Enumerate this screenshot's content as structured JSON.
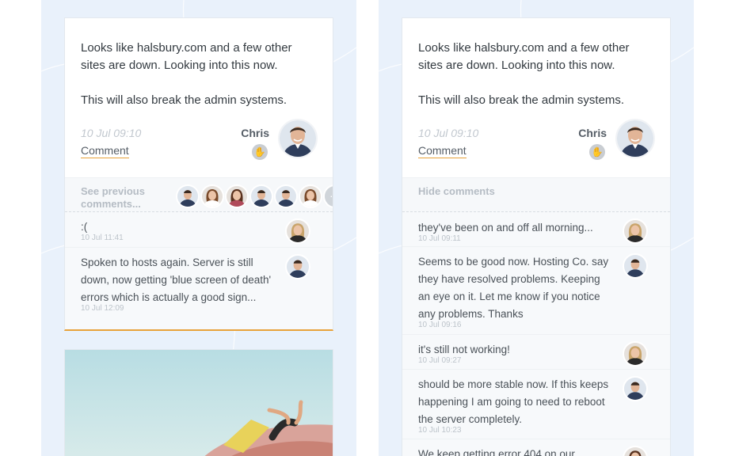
{
  "left_card": {
    "post_line1": "Looks like halsbury.com and a few other sites are down. Looking into this now.",
    "post_line2": "This will also break the admin systems.",
    "date": "10 Jul 09:10",
    "comment_link": "Comment",
    "author": "Chris",
    "author_avatar": "avatar-man-icon",
    "hand_icon": "hand-wave-icon",
    "see_previous": "See previous comments...",
    "face_icons": [
      "avatar-man-icon",
      "avatar-woman-icon",
      "avatar-woman-icon",
      "avatar-man-icon",
      "avatar-man-icon",
      "avatar-woman-icon"
    ],
    "more_dots": "···",
    "comments": [
      {
        "text": ":(",
        "time": "10 Jul 11:41",
        "avatar": "avatar-woman-icon"
      },
      {
        "text": "Spoken to hosts again. Server is still down, now getting 'blue screen of death' errors which is actually a good sign...",
        "time": "10 Jul 12:09",
        "avatar": "avatar-man-icon"
      }
    ]
  },
  "right_card": {
    "post_line1": "Looks like halsbury.com and a few other sites are down. Looking into this now.",
    "post_line2": "This will also break the admin systems.",
    "date": "10 Jul 09:10",
    "comment_link": "Comment",
    "author": "Chris",
    "author_avatar": "avatar-man-icon",
    "hand_icon": "hand-wave-icon",
    "hide_comments": "Hide comments",
    "comments": [
      {
        "text": "they've been on and off all morning...",
        "time": "10 Jul 09:11",
        "avatar": "avatar-woman-icon"
      },
      {
        "text": "Seems to be good now. Hosting Co. say they have resolved problems. Keeping an eye on it. Let me know if you notice any problems. Thanks",
        "time": "10 Jul 09:16",
        "avatar": "avatar-man-icon"
      },
      {
        "text": "it's still not working!",
        "time": "10 Jul 09:27",
        "avatar": "avatar-woman-icon"
      },
      {
        "text": "should be more stable now. If this keeps happening I am going to need to reboot the server completely.",
        "time": "10 Jul 10:23",
        "avatar": "avatar-man-icon"
      },
      {
        "text": "We keep getting error 404 on our",
        "time": "",
        "avatar": "avatar-woman-icon"
      }
    ]
  },
  "photo": {
    "icon": "photo-bouncy-castle-icon"
  },
  "colors": {
    "accent": "#e8a23a",
    "background": "#e9f1fb",
    "card": "#ffffff"
  }
}
